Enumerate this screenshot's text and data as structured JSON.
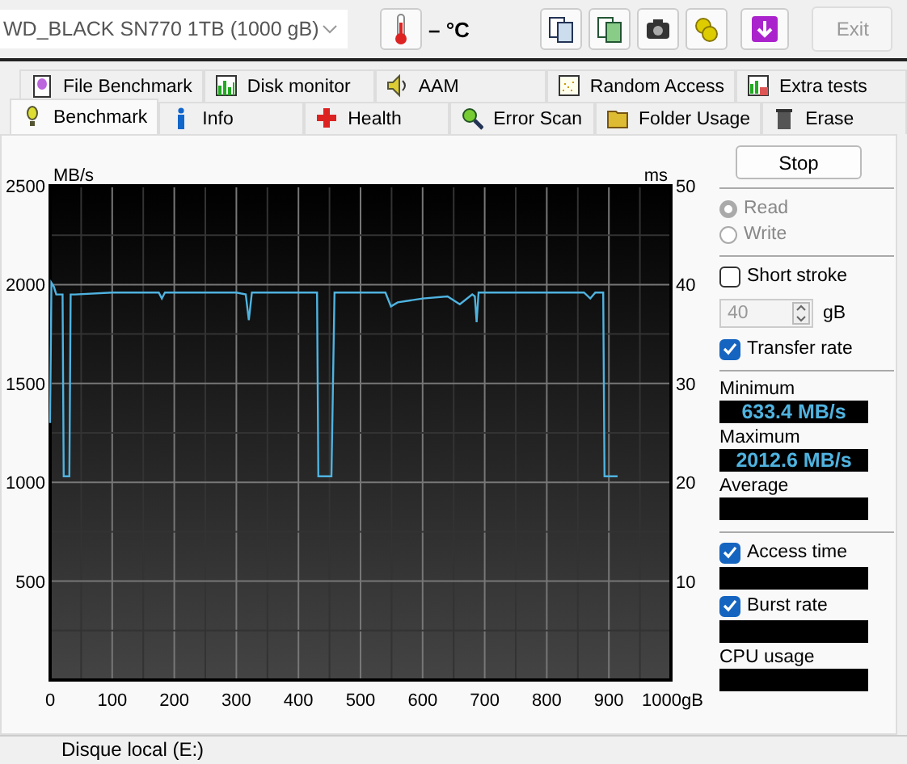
{
  "drive_select": {
    "value": "WD_BLACK SN770 1TB (1000 gB)"
  },
  "temperature": {
    "reading": "– °C"
  },
  "exit_button": {
    "label": "Exit",
    "disabled": true
  },
  "tabs": [
    [
      {
        "label": "File Benchmark",
        "selected": false
      },
      {
        "label": "Disk monitor",
        "selected": false
      },
      {
        "label": "AAM",
        "selected": false
      },
      {
        "label": "Random Access",
        "selected": false
      },
      {
        "label": "Extra tests",
        "selected": false
      }
    ],
    [
      {
        "label": "Benchmark",
        "selected": true
      },
      {
        "label": "Info",
        "selected": false
      },
      {
        "label": "Health",
        "selected": false
      },
      {
        "label": "Error Scan",
        "selected": false
      },
      {
        "label": "Folder Usage",
        "selected": false
      },
      {
        "label": "Erase",
        "selected": false
      }
    ]
  ],
  "benchmark": {
    "chart_data": {
      "type": "line",
      "ylabel": "MB/s",
      "xlim": [
        0,
        1000
      ],
      "ylim": [
        0,
        2500
      ],
      "grid": true,
      "x": [
        0,
        2,
        6,
        10,
        20,
        22,
        31,
        33,
        40,
        100,
        175,
        180,
        185,
        300,
        315,
        320,
        325,
        430,
        432,
        453,
        458,
        540,
        549,
        560,
        580,
        600,
        640,
        660,
        680,
        684,
        687,
        690,
        700,
        800,
        860,
        870,
        878,
        891,
        893,
        914
      ],
      "series": [
        {
          "color": "#4fb3e0",
          "values": [
            1300,
            2010,
            1990,
            1950,
            1950,
            1030,
            1030,
            1950,
            1950,
            1960,
            1960,
            1930,
            1960,
            1960,
            1950,
            1820,
            1960,
            1960,
            1030,
            1030,
            1960,
            1960,
            1890,
            1910,
            1920,
            1930,
            1940,
            1900,
            1950,
            1940,
            1810,
            1960,
            1960,
            1960,
            1960,
            1930,
            1960,
            1960,
            1030,
            1030
          ]
        }
      ],
      "xticks": [
        0,
        100,
        200,
        300,
        400,
        500,
        600,
        700,
        800,
        900,
        {
          "value": 1000,
          "label": "1000gB"
        }
      ],
      "yticks": [
        500,
        1000,
        1500,
        2000,
        2500
      ]
    },
    "right_axis": {
      "label": "ms",
      "ticks": [
        "50",
        "40",
        "30",
        "20",
        "10"
      ]
    }
  },
  "side_panel": {
    "stop_button": {
      "label": "Stop"
    },
    "modes": [
      {
        "label": "Read",
        "selected": true,
        "disabled": true
      },
      {
        "label": "Write",
        "selected": false,
        "disabled": true
      }
    ],
    "short_stroke": {
      "label": "Short stroke",
      "checked": false
    },
    "stroke_size": {
      "value": "40",
      "unit": "gB",
      "disabled": true
    },
    "transfer_rate": {
      "label": "Transfer rate",
      "checked": true
    },
    "readings": [
      {
        "label": "Minimum",
        "value": "633.4 MB/s"
      },
      {
        "label": "Maximum",
        "value": "2012.6 MB/s"
      },
      {
        "label": "Average"
      }
    ],
    "access_time": {
      "label": "Access time",
      "checked": true
    },
    "burst_rate": {
      "label": "Burst rate",
      "checked": true
    },
    "cpu_usage": {
      "label": "CPU usage"
    }
  },
  "bottom_item": {
    "label": "Disque local (E:)"
  }
}
